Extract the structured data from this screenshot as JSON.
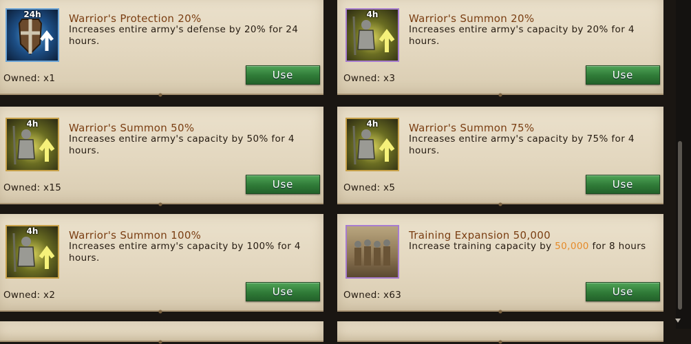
{
  "items": [
    {
      "title": "Warrior's Protection 20%",
      "desc": "Increases entire army's defense by 20% for 24 hours.",
      "owned": "Owned: x1",
      "timer": "24h",
      "icon": "shield-icon",
      "button": "Use"
    },
    {
      "title": "Warrior's Summon 20%",
      "desc": "Increases entire army's capacity by 20% for 4 hours.",
      "owned": "Owned: x3",
      "timer": "4h",
      "icon": "warrior-icon",
      "button": "Use"
    },
    {
      "title": "Warrior's Summon 50%",
      "desc": "Increases entire army's capacity by 50% for 4 hours.",
      "owned": "Owned: x15",
      "timer": "4h",
      "icon": "warrior-icon",
      "button": "Use"
    },
    {
      "title": "Warrior's Summon 75%",
      "desc": "Increases entire army's capacity by 75% for 4 hours.",
      "owned": "Owned: x5",
      "timer": "4h",
      "icon": "warrior-icon",
      "button": "Use"
    },
    {
      "title": "Warrior's Summon 100%",
      "desc": "Increases entire army's capacity by 100% for 4 hours.",
      "owned": "Owned: x2",
      "timer": "4h",
      "icon": "warrior-icon",
      "button": "Use"
    },
    {
      "title": "Training Expansion 50,000",
      "desc_pre": "Increase training capacity by ",
      "desc_value": "50,000",
      "desc_post": " for 8 hours",
      "owned": "Owned: x63",
      "icon": "soldiers-icon",
      "button": "Use"
    }
  ],
  "colors": {
    "title": "#7a3e12",
    "highlight": "#e58a28",
    "button": "#2f7a37"
  }
}
